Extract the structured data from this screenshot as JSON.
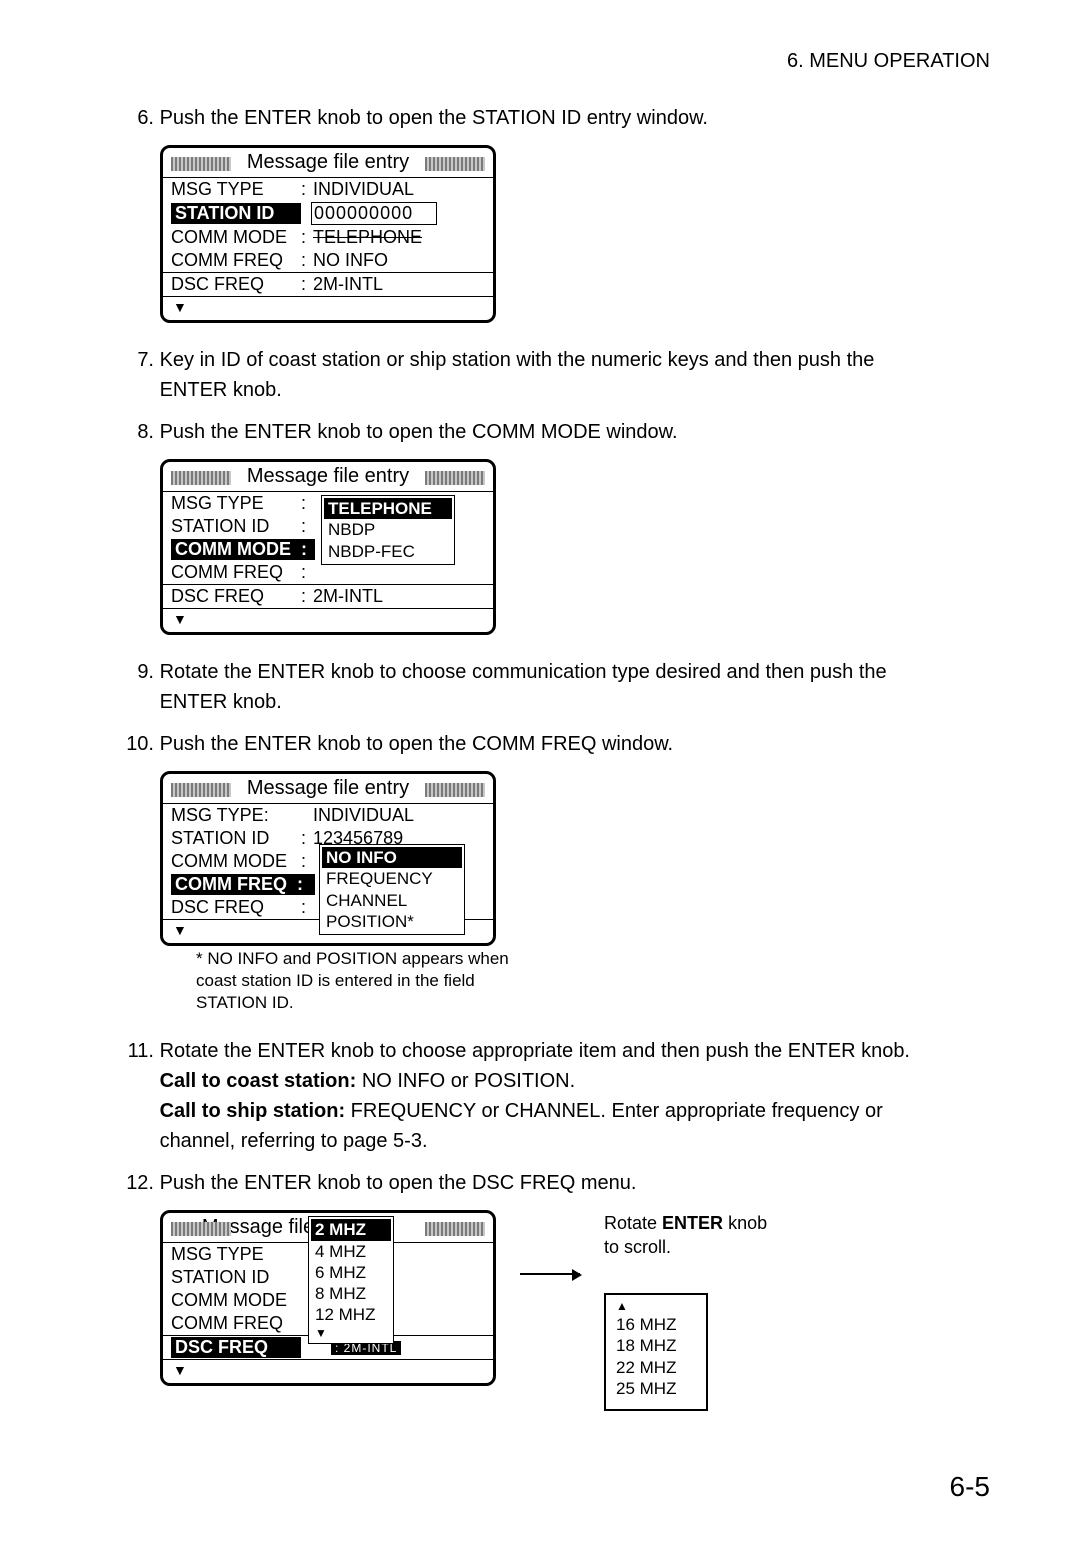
{
  "header": "6.  MENU  OPERATION",
  "steps": {
    "s6": "Push the ENTER knob to open the STATION ID entry window.",
    "s7": "Key in ID of coast station or ship station with the numeric keys and then push the ENTER knob.",
    "s8": "Push the ENTER knob to open the COMM MODE window.",
    "s9": "Rotate the ENTER knob to choose communication type desired and then push the ENTER knob.",
    "s10": "Push the ENTER knob to open the COMM FREQ window.",
    "s11a": "Rotate the ENTER knob to choose appropriate item and then push the ENTER knob.",
    "s11b_label": "Call to coast station:",
    "s11b_val": " NO INFO or POSITION.",
    "s11c_label": "Call to ship station:",
    "s11c_val": "  FREQUENCY or CHANNEL. Enter appropriate frequency or channel, referring to page 5-3.",
    "s12": "Push the ENTER knob to open the DSC FREQ menu."
  },
  "panel_title": "Message file entry",
  "panel1": {
    "msg_type_label": "MSG  TYPE",
    "msg_type_val": "INDIVIDUAL",
    "station_label": "STATION ID",
    "station_val": "000000000",
    "comm_mode_label": "COMM MODE",
    "comm_mode_val": "TELEPHONE",
    "comm_freq_label": "COMM FREQ",
    "comm_freq_val": "NO  INFO",
    "dsc_label": "DSC  FREQ",
    "dsc_val": "2M-INTL"
  },
  "panel2": {
    "msg_type_label": "MSG  TYPE",
    "station_label": "STATION ID",
    "comm_mode_label": "COMM MODE",
    "comm_freq_label": "COMM FREQ",
    "dsc_label": "DSC  FREQ",
    "dsc_val": "2M-INTL",
    "opts": {
      "o1": "TELEPHONE",
      "o2": "NBDP",
      "o3": "NBDP-FEC"
    }
  },
  "panel3": {
    "msg_type_label": "MSG  TYPE:",
    "msg_type_val": "INDIVIDUAL",
    "station_label": "STATION ID",
    "station_val": "123456789",
    "comm_mode_label": "COMM MODE",
    "comm_freq_label": "COMM FREQ",
    "dsc_label": "DSC  FREQ",
    "opts": {
      "o1": "NO INFO",
      "o2": "FREQUENCY",
      "o3": "CHANNEL",
      "o4": "POSITION*"
    }
  },
  "panel3_note": "* NO INFO and POSITION appears when coast station ID is entered in the field STATION ID.",
  "panel4": {
    "msg_type_label": "MSG  TYPE",
    "station_label": "STATION ID",
    "comm_mode_label": "COMM MODE",
    "comm_freq_label": "COMM FREQ",
    "dsc_label": "DSC  FREQ",
    "dsc_val_frag": "2M-INTL",
    "opts": {
      "o1": "2 MHZ",
      "o2": "4 MHZ",
      "o3": "6 MHZ",
      "o4": "8 MHZ",
      "o5": "12 MHZ"
    },
    "annot1a": "Rotate ",
    "annot1b": "ENTER",
    "annot1c": " knob",
    "annot2": "to scroll.",
    "scroll": {
      "r1": "16 MHZ",
      "r2": "18 MHZ",
      "r3": "22 MHZ",
      "r4": "25 MHZ"
    }
  },
  "nums": {
    "n6": "6.",
    "n7": "7.",
    "n8": "8.",
    "n9": "9.",
    "n10": "10.",
    "n11": "11.",
    "n12": "12."
  },
  "page_number": "6-5",
  "glyph_down": "▼",
  "glyph_up": "▲",
  "glyph_colon": ":"
}
